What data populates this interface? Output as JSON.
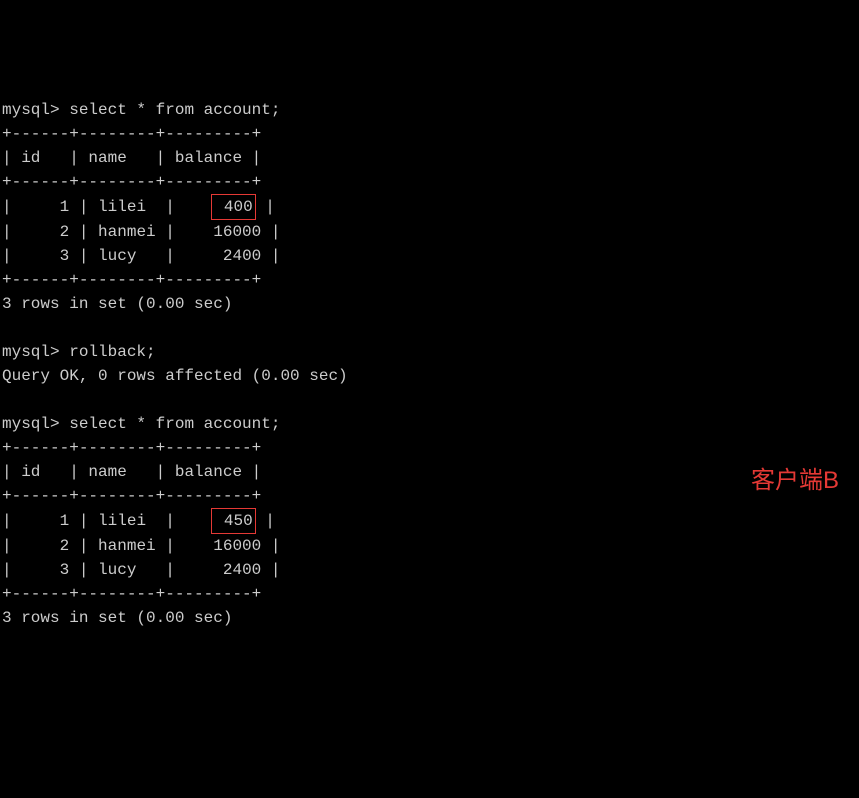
{
  "prompts": {
    "mysql": "mysql>",
    "cmd1": "select * from account;",
    "cmd2": "rollback;",
    "cmd3": "select * from account;",
    "rollback_result": "Query OK, 0 rows affected (0.00 sec)",
    "rows_in_set": "3 rows in set (0.00 sec)"
  },
  "columns": {
    "id": "id",
    "name": "name",
    "balance": "balance"
  },
  "divider": "+------+--------+---------+",
  "table1": {
    "rows": [
      {
        "id": "1",
        "name": "lilei",
        "balance": "400"
      },
      {
        "id": "2",
        "name": "hanmei",
        "balance": "16000"
      },
      {
        "id": "3",
        "name": "lucy",
        "balance": "2400"
      }
    ]
  },
  "table2": {
    "rows": [
      {
        "id": "1",
        "name": "lilei",
        "balance": "450"
      },
      {
        "id": "2",
        "name": "hanmei",
        "balance": "16000"
      },
      {
        "id": "3",
        "name": "lucy",
        "balance": "2400"
      }
    ]
  },
  "client_label": "客户端B"
}
